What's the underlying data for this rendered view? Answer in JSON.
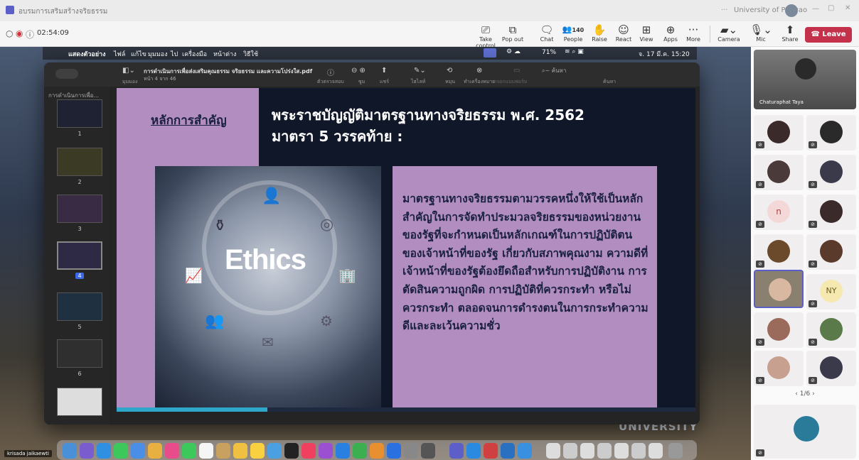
{
  "window": {
    "title": "อบรมการเสริมสร้างจริยธรรม",
    "org": "University of Phayao",
    "menu_dots": "···"
  },
  "call": {
    "timer": "02:54:09",
    "buttons": [
      {
        "label": "Take control",
        "icon": "take-control-icon"
      },
      {
        "label": "Pop out",
        "icon": "pop-out-icon"
      },
      {
        "label": "Chat",
        "icon": "chat-icon"
      },
      {
        "label": "People",
        "icon": "people-icon",
        "count": "140"
      },
      {
        "label": "Raise",
        "icon": "raise-hand-icon"
      },
      {
        "label": "React",
        "icon": "react-icon"
      },
      {
        "label": "View",
        "icon": "view-icon"
      },
      {
        "label": "Apps",
        "icon": "apps-icon"
      },
      {
        "label": "More",
        "icon": "more-icon"
      },
      {
        "label": "Camera",
        "icon": "camera-off-icon"
      },
      {
        "label": "Mic",
        "icon": "mic-off-icon"
      },
      {
        "label": "Share",
        "icon": "share-icon"
      }
    ],
    "leave": "Leave"
  },
  "macmenu": {
    "items": [
      "แสดงตัวอย่าง",
      "ไฟล์",
      "แก้ไข",
      "มุมมอง",
      "ไป",
      "เครื่องมือ",
      "หน้าต่าง",
      "วิธีใช้"
    ],
    "battery": "71%",
    "datetime": "จ. 17 มี.ค.  15:20"
  },
  "pdf": {
    "filename": "การดำเนินการเพื่อส่งเสริมคุณธรรม จริยธรรม และความโปร่งใส.pdf",
    "page": "หน้า 4 จาก 46",
    "view_label": "มุมมอง",
    "sidebar_heading": "การดำเนินการเพื่อ...",
    "tools": [
      "ตัวตรวจสอบ",
      "ซูม",
      "แชร์",
      "ไฮไลท์",
      "หมุน",
      "ทำเครื่องหมาย",
      "กรอกแบบฟอร์ม",
      "ค้นหา"
    ],
    "search_placeholder": "ค้นหา",
    "thumb_numbers": [
      "1",
      "2",
      "3",
      "4",
      "5",
      "6"
    ]
  },
  "slide": {
    "badge": "หลักการสำคัญ",
    "title_line1": "พระราชบัญญัติมาตรฐานทางจริยธรรม พ.ศ. 2562",
    "title_line2": "มาตรา 5 วรรคท้าย :",
    "image_word": "Ethics",
    "body": "มาตรฐานทางจริยธรรมตามวรรคหนึ่งให้ใช้เป็นหลักสำคัญในการจัดทำประมวลจริยธรรมของหน่วยงานของรัฐที่จะกำหนดเป็นหลักเกณฑ์ในการปฏิบัติตนของเจ้าหน้าที่ของรัฐ เกี่ยวกับสภาพคุณงาม ความดีที่เจ้าหน้าที่ของรัฐต้องยึดถือสำหรับการปฏิบัติงาน การตัดสินความถูกผิด การปฏิบัติที่ควรกระทำ หรือไม่ควรกระทำ ตลอดจนการดำรงตนในการกระทำความดีและละเว้นความชั่ว"
  },
  "background": {
    "university": "UNIVERSITY"
  },
  "participants": {
    "featured": "Chaturaphat Taya",
    "pagination": "1/6",
    "initials": [
      "n",
      "NY"
    ],
    "presenter": "krisada jaikaewti"
  },
  "colors": {
    "leave": "#c4314b",
    "slide_bg": "#101729",
    "lilac": "#b28ec0",
    "accent": "#4a5a9a"
  }
}
